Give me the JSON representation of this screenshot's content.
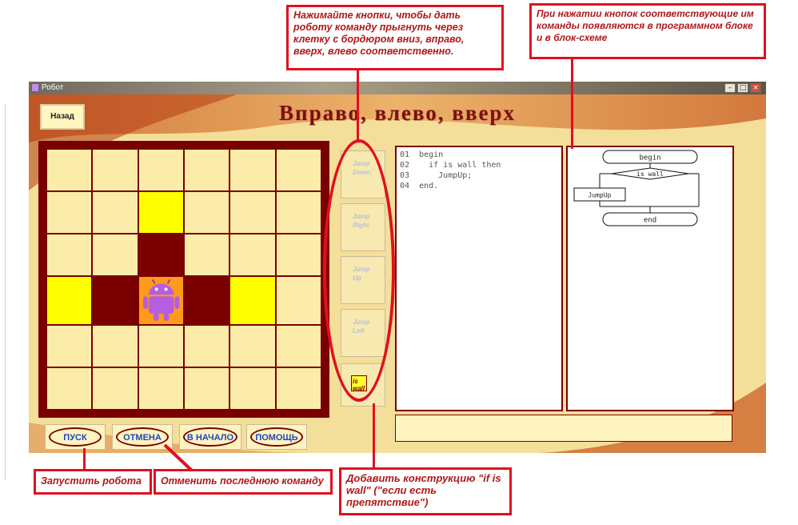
{
  "window": {
    "title": "Робот",
    "min_glyph": "–",
    "max_glyph": "□",
    "close_glyph": "×",
    "icon": "robot-app-icon"
  },
  "header": {
    "back_label": "Назад",
    "title": "Вправо, влево, вверх"
  },
  "board": {
    "rows": 6,
    "cols": 6,
    "cells": [
      [
        "empty",
        "empty",
        "empty",
        "empty",
        "empty",
        "empty"
      ],
      [
        "empty",
        "empty",
        "yellow",
        "empty",
        "empty",
        "empty"
      ],
      [
        "empty",
        "empty",
        "wall",
        "empty",
        "empty",
        "empty"
      ],
      [
        "yellow",
        "wall",
        "robot",
        "wall",
        "yellow",
        "empty"
      ],
      [
        "empty",
        "empty",
        "empty",
        "empty",
        "empty",
        "empty"
      ],
      [
        "empty",
        "empty",
        "empty",
        "empty",
        "empty",
        "empty"
      ]
    ],
    "robot_icon": "android-robot-icon"
  },
  "commands": [
    {
      "id": "jump-down",
      "line1": "Jump",
      "line2": "Down"
    },
    {
      "id": "jump-right",
      "line1": "Jump",
      "line2": "Right"
    },
    {
      "id": "jump-up",
      "line1": "Jump",
      "line2": "Up"
    },
    {
      "id": "jump-left",
      "line1": "Jump",
      "line2": "Left"
    }
  ],
  "is_wall": {
    "line1": "is",
    "line2": "wall"
  },
  "program": {
    "lines": [
      "01  begin",
      "02    if is wall then",
      "03      JumpUp;",
      "04  end."
    ]
  },
  "flowchart": {
    "begin": "begin",
    "condition": "is wall",
    "action": "JumpUp",
    "end": "end"
  },
  "bottom_buttons": [
    "ПУСК",
    "ОТМЕНА",
    "В НАЧАЛО",
    "ПОМОЩЬ"
  ],
  "annotations": {
    "commands_hint": "Нажимайте кнопки, чтобы дать роботу команду прыгнуть через клетку с бордюром вниз, вправо, вверх, влево соответственно.",
    "blocks_hint": "При нажатии кнопок соответствующие им команды появляются в программном блоке и в блок-схеме",
    "run_hint": "Запустить робота",
    "undo_hint": "Отменить последнюю команду",
    "iswall_hint": "Добавить конструкцию \"if is wall\" (\"если есть препятствие\")"
  },
  "colors": {
    "wall": "#7a0000",
    "target": "#ffff00",
    "empty": "#fbeca9",
    "robot_cell": "#ff9a1a",
    "annotation_border": "#e01020",
    "button_text": "#1f44c6"
  }
}
